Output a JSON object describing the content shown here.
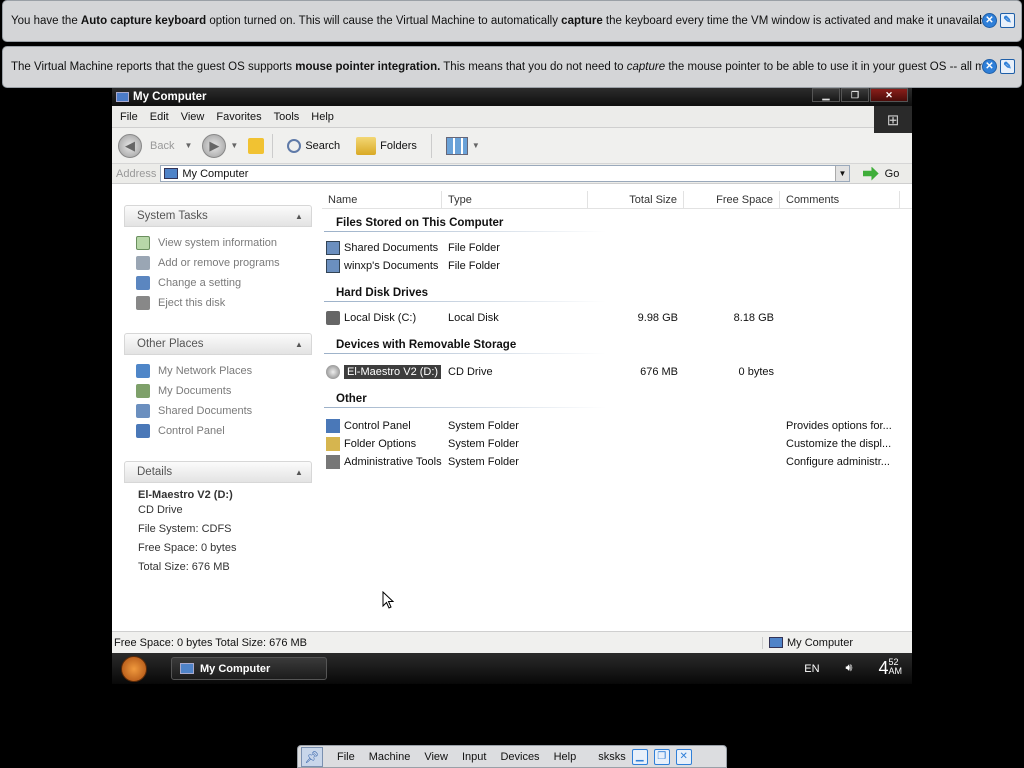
{
  "notices": [
    {
      "pre": "You have the ",
      "bold1": "Auto capture keyboard",
      "mid": " option turned on. This will cause the Virtual Machine to automatically ",
      "bold2": "capture",
      "post": " the keyboard every time the VM window is activated and make it unavailable to"
    },
    {
      "pre": "The Virtual Machine reports that the guest OS supports ",
      "bold1": "mouse pointer integration.",
      "mid": " This means that you do not need to ",
      "italic": "capture",
      "post": " the mouse pointer to be able to use it in your guest OS -- all mouse"
    }
  ],
  "window": {
    "title": "My Computer",
    "menu": [
      "File",
      "Edit",
      "View",
      "Favorites",
      "Tools",
      "Help"
    ],
    "toolbar": {
      "back": "Back",
      "search": "Search",
      "folders": "Folders"
    },
    "address": {
      "label": "Address",
      "value": "My Computer",
      "go": "Go"
    }
  },
  "sidebar": {
    "system_tasks": {
      "title": "System Tasks",
      "items": [
        "View system information",
        "Add or remove programs",
        "Change a setting",
        "Eject this disk"
      ]
    },
    "other_places": {
      "title": "Other Places",
      "items": [
        "My Network Places",
        "My Documents",
        "Shared Documents",
        "Control Panel"
      ]
    },
    "details": {
      "title": "Details",
      "name": "El-Maestro V2 (D:)",
      "type": "CD Drive",
      "fs": "File System: CDFS",
      "free": "Free Space: 0 bytes",
      "total": "Total Size: 676 MB"
    }
  },
  "columns": [
    "Name",
    "Type",
    "Total Size",
    "Free Space",
    "Comments"
  ],
  "groups": {
    "files": "Files Stored on This Computer",
    "hdd": "Hard Disk Drives",
    "removable": "Devices with Removable Storage",
    "other": "Other"
  },
  "rows": {
    "shared": {
      "name": "Shared Documents",
      "type": "File Folder"
    },
    "winxp": {
      "name": "winxp's Documents",
      "type": "File Folder"
    },
    "local": {
      "name": "Local Disk (C:)",
      "type": "Local Disk",
      "total": "9.98 GB",
      "free": "8.18 GB"
    },
    "cd": {
      "name": "El-Maestro V2 (D:)",
      "type": "CD Drive",
      "total": "676 MB",
      "free": "0 bytes"
    },
    "cpanel": {
      "name": "Control Panel",
      "type": "System Folder",
      "comment": "Provides options for..."
    },
    "folderopts": {
      "name": "Folder Options",
      "type": "System Folder",
      "comment": "Customize the displ..."
    },
    "admintools": {
      "name": "Administrative Tools",
      "type": "System Folder",
      "comment": "Configure administr..."
    }
  },
  "status": {
    "left": "Free Space: 0 bytes Total Size: 676 MB",
    "right": "My Computer"
  },
  "taskbar": {
    "app": "My Computer",
    "lang": "EN",
    "clock_hour": "4",
    "clock_min": "52",
    "clock_ampm": "AM"
  },
  "minibar": {
    "menus": [
      "File",
      "Machine",
      "View",
      "Input",
      "Devices",
      "Help"
    ],
    "vm_name": "sksks"
  }
}
